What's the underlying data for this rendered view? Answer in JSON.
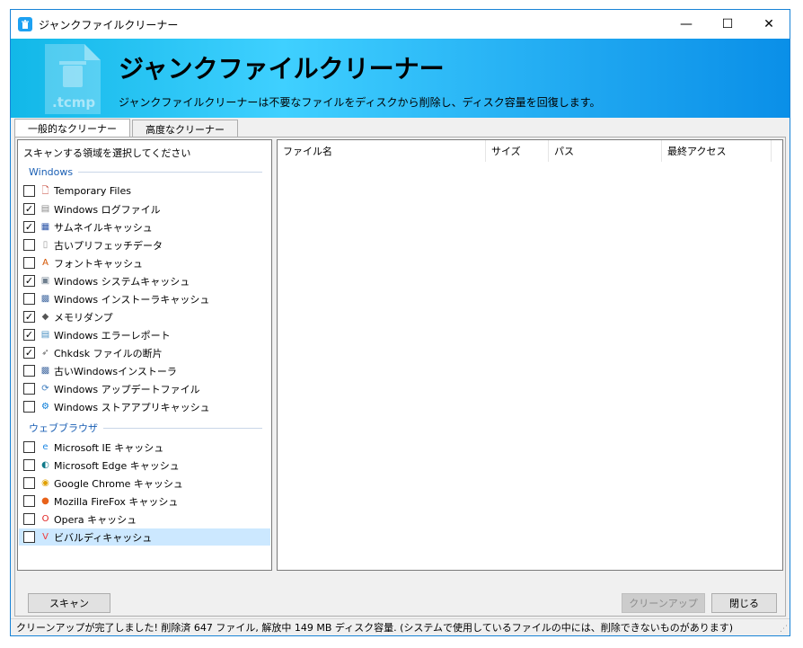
{
  "window": {
    "title": "ジャンクファイルクリーナー",
    "controls": {
      "minimize": "—",
      "maximize": "☐",
      "close": "✕"
    }
  },
  "banner": {
    "graphic_label": ".tcmp",
    "title": "ジャンクファイルクリーナー",
    "description": "ジャンクファイルクリーナーは不要なファイルをディスクから削除し、ディスク容量を回復します。"
  },
  "tabs": [
    {
      "label": "一般的なクリーナー",
      "active": true
    },
    {
      "label": "高度なクリーナー",
      "active": false
    }
  ],
  "left_pane": {
    "heading": "スキャンする領域を選択してください",
    "groups": [
      {
        "label": "Windows",
        "items": [
          {
            "label": "Temporary Files",
            "checked": false,
            "icon": "temp-files-icon",
            "glyph": "🗋",
            "color": "#c0392b"
          },
          {
            "label": "Windows ログファイル",
            "checked": true,
            "icon": "log-file-icon",
            "glyph": "▤",
            "color": "#888888"
          },
          {
            "label": "サムネイルキャッシュ",
            "checked": true,
            "icon": "thumbnail-icon",
            "glyph": "▦",
            "color": "#2c55a8"
          },
          {
            "label": "古いプリフェッチデータ",
            "checked": false,
            "icon": "prefetch-icon",
            "glyph": "▯",
            "color": "#9a9a9a"
          },
          {
            "label": "フォントキャッシュ",
            "checked": false,
            "icon": "font-icon",
            "glyph": "A",
            "color": "#d35400"
          },
          {
            "label": "Windows システムキャッシュ",
            "checked": true,
            "icon": "system-cache-icon",
            "glyph": "▣",
            "color": "#6f7f8f"
          },
          {
            "label": "Windows インストーラキャッシュ",
            "checked": false,
            "icon": "installer-icon",
            "glyph": "▩",
            "color": "#4a6fa5"
          },
          {
            "label": "メモリダンプ",
            "checked": true,
            "icon": "memory-dump-icon",
            "glyph": "◆",
            "color": "#555555"
          },
          {
            "label": "Windows エラーレポート",
            "checked": true,
            "icon": "error-report-icon",
            "glyph": "▤",
            "color": "#4a90c2"
          },
          {
            "label": "Chkdsk ファイルの断片",
            "checked": true,
            "icon": "chkdsk-icon",
            "glyph": "➶",
            "color": "#666666"
          },
          {
            "label": "古いWindowsインストーラ",
            "checked": false,
            "icon": "old-installer-icon",
            "glyph": "▩",
            "color": "#4a6fa5"
          },
          {
            "label": "Windows アップデートファイル",
            "checked": false,
            "icon": "update-icon",
            "glyph": "⟳",
            "color": "#3d7dbf"
          },
          {
            "label": "Windows ストアアプリキャッシュ",
            "checked": false,
            "icon": "store-icon",
            "glyph": "⚙",
            "color": "#0078d7"
          }
        ]
      },
      {
        "label": "ウェブブラウザ",
        "items": [
          {
            "label": "Microsoft IE キャッシュ",
            "checked": false,
            "icon": "ie-icon",
            "glyph": "e",
            "color": "#1e88e5"
          },
          {
            "label": "Microsoft Edge キャッシュ",
            "checked": false,
            "icon": "edge-icon",
            "glyph": "◐",
            "color": "#0f7a8a"
          },
          {
            "label": "Google Chrome キャッシュ",
            "checked": false,
            "icon": "chrome-icon",
            "glyph": "◉",
            "color": "#e0a000"
          },
          {
            "label": "Mozilla FireFox キャッシュ",
            "checked": false,
            "icon": "firefox-icon",
            "glyph": "●",
            "color": "#e8621a"
          },
          {
            "label": "Opera キャッシュ",
            "checked": false,
            "icon": "opera-icon",
            "glyph": "O",
            "color": "#e0201f"
          },
          {
            "label": "ビバルディキャッシュ",
            "checked": false,
            "icon": "vivaldi-icon",
            "glyph": "V",
            "color": "#ef3939",
            "selected": true
          }
        ]
      }
    ]
  },
  "file_list": {
    "columns": [
      "ファイル名",
      "サイズ",
      "パス",
      "最終アクセス"
    ]
  },
  "buttons": {
    "scan": "スキャン",
    "cleanup": "クリーンアップ",
    "close": "閉じる"
  },
  "status": "クリーンアップが完了しました! 削除済 647 ファイル, 解放中 149 MB ディスク容量. (システムで使用しているファイルの中には、削除できないものがあります)"
}
